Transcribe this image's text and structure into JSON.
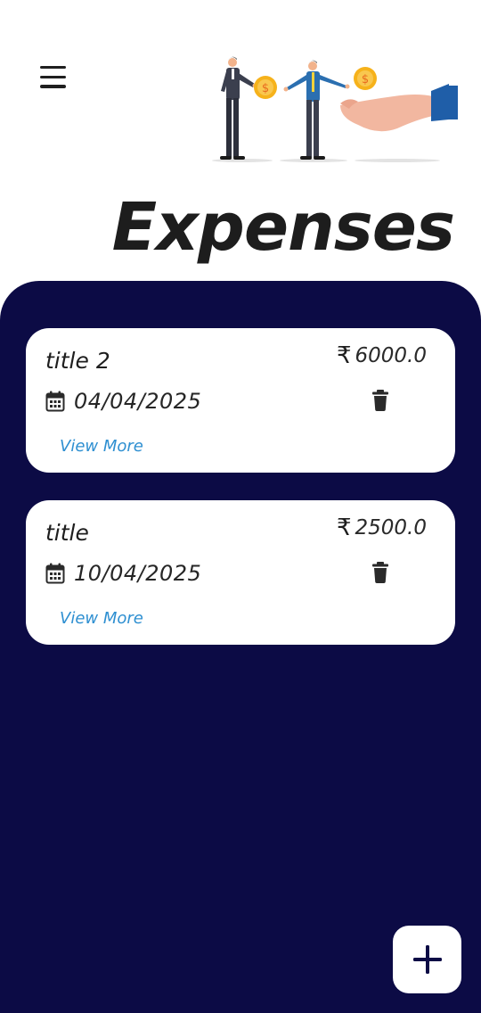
{
  "header": {
    "menu_icon": "hamburger-menu-icon",
    "illustration": "business-people-exchanging-money-illustration",
    "title": "Expenses"
  },
  "colors": {
    "panel_background": "#0c0b45",
    "link": "#2e8fd1",
    "card_background": "#ffffff"
  },
  "expenses": [
    {
      "title": "title 2",
      "currency_symbol": "₹",
      "amount": "6000.0",
      "date": "04/04/2025",
      "view_more_label": "View More"
    },
    {
      "title": "title",
      "currency_symbol": "₹",
      "amount": "2500.0",
      "date": "10/04/2025",
      "view_more_label": "View More"
    }
  ],
  "fab": {
    "icon": "plus-icon"
  }
}
